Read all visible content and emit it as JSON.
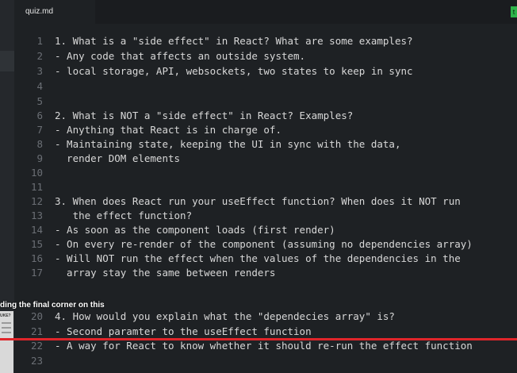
{
  "tab": {
    "label": "quiz.md"
  },
  "badge": {
    "label": "t"
  },
  "overlay": {
    "text": "ding the final corner on this",
    "thumbnail_text": "UKE?"
  },
  "editor": {
    "lines": [
      {
        "number": "1",
        "text": "1. What is a \"side effect\" in React? What are some examples?"
      },
      {
        "number": "2",
        "text": "- Any code that affects an outside system."
      },
      {
        "number": "3",
        "text": "- local storage, API, websockets, two states to keep in sync"
      },
      {
        "number": "4",
        "text": ""
      },
      {
        "number": "5",
        "text": ""
      },
      {
        "number": "6",
        "text": "2. What is NOT a \"side effect\" in React? Examples?"
      },
      {
        "number": "7",
        "text": "- Anything that React is in charge of."
      },
      {
        "number": "8",
        "text": "- Maintaining state, keeping the UI in sync with the data,"
      },
      {
        "number": "9",
        "text": "  render DOM elements"
      },
      {
        "number": "10",
        "text": ""
      },
      {
        "number": "11",
        "text": ""
      },
      {
        "number": "12",
        "text": "3. When does React run your useEffect function? When does it NOT run"
      },
      {
        "number": "13",
        "text": "   the effect function?"
      },
      {
        "number": "14",
        "text": "- As soon as the component loads (first render)"
      },
      {
        "number": "15",
        "text": "- On every re-render of the component (assuming no dependencies array)"
      },
      {
        "number": "16",
        "text": "- Will NOT run the effect when the values of the dependencies in the"
      },
      {
        "number": "17",
        "text": "  array stay the same between renders"
      },
      {
        "number": "20",
        "text": "4. How would you explain what the \"dependecies array\" is?"
      },
      {
        "number": "21",
        "text": "- Second paramter to the useEffect function"
      },
      {
        "number": "22",
        "text": "- A way for React to know whether it should re-run the effect function"
      },
      {
        "number": "23",
        "text": ""
      }
    ]
  },
  "colors": {
    "background": "#1e2124",
    "progress": "#e0252a",
    "badge": "#2fb34a"
  }
}
